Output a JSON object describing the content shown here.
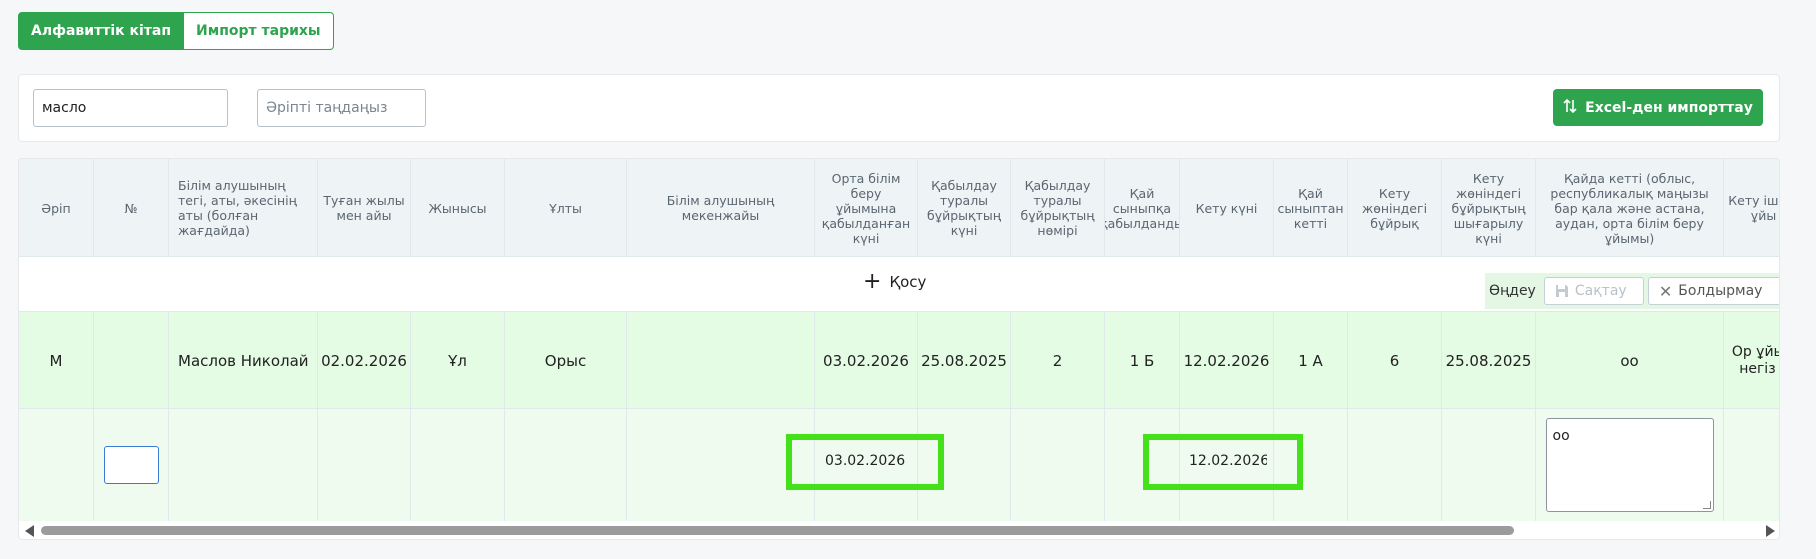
{
  "tabs": {
    "alphabet": "Алфавиттік кітап",
    "import_history": "Импорт тарихы"
  },
  "filters": {
    "search_value": "масло",
    "letter_placeholder": "Әріпті таңдаңыз",
    "import_button": "Excel-ден импорттау"
  },
  "headers": {
    "letter": "Әріп",
    "number": "№",
    "full_name": "Білім алушының тегі, аты, әкесінің аты (болған жағдайда)",
    "birth": "Туған жылы мен айы",
    "gender": "Жынысы",
    "nationality": "Ұлты",
    "address": "Білім алушының мекенжайы",
    "admission_date": "Орта білім беру ұйымына қабылданған күні",
    "order_date": "Қабылдау туралы бұйрықтың күні",
    "order_number": "Қабылдау туралы бұйрықтың нөмірі",
    "admitted_class": "Қай сыныпқа қабылданды",
    "leave_date": "Кету күні",
    "left_class": "Қай сыныптан кетті",
    "leave_order": "Кету жөніндегі бұйрық",
    "leave_order_date": "Кету жөніндегі бұйрықтың шығарылу күні",
    "destination": "Қайда кетті (облыс, республикалық маңызы бар қала және астана, аудан, орта білім беру ұйымы)",
    "leave_reason": "Кету ішінд ұйы"
  },
  "actions": {
    "add": "Қосу",
    "edit": "Өңдеу",
    "save": "Сақтау",
    "cancel": "Болдырмау"
  },
  "record": {
    "letter": "М",
    "number": "",
    "full_name": "Маслов Николай",
    "birth": "02.02.2026",
    "gender": "Ұл",
    "nationality": "Орыс",
    "address": "",
    "admission_date": "03.02.2026",
    "order_date": "25.08.2025",
    "order_number": "2",
    "admitted_class": "1 Б",
    "leave_date": "12.02.2026",
    "left_class": "1 А",
    "leave_order": "6",
    "leave_order_date": "25.08.2025",
    "destination": "оо",
    "last_col": "Ор ұйым негіз с"
  },
  "edit_row": {
    "admission_date": "03.02.2026",
    "leave_date": "12.02.2026",
    "destination": "оо"
  },
  "colors": {
    "accent": "#2ea44f",
    "highlight": "#44e01a",
    "row_bg": "#e4fbe4"
  }
}
